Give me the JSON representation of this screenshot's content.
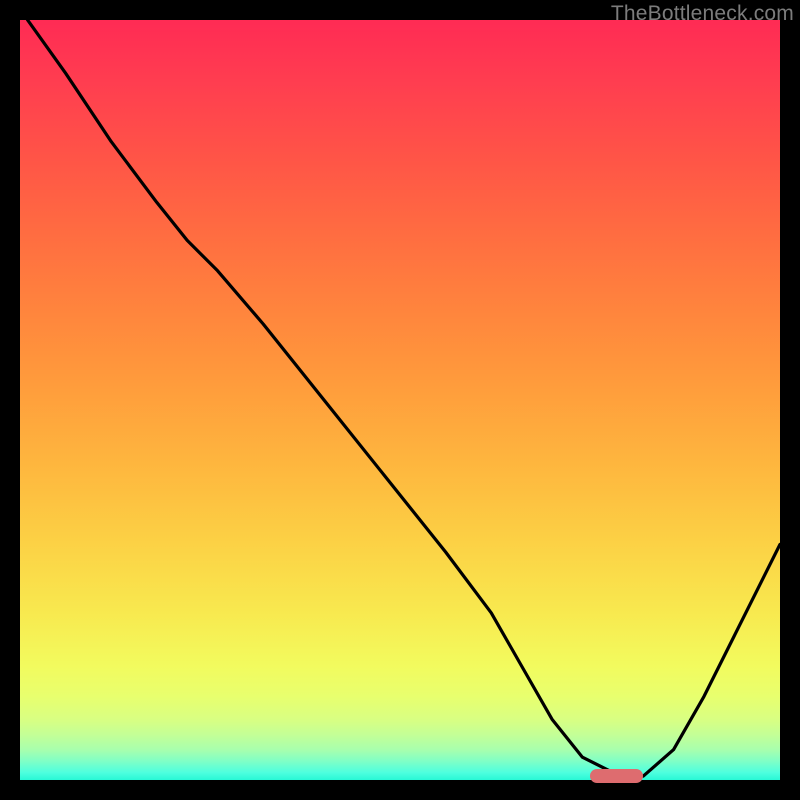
{
  "watermark_text": "TheBottleneck.com",
  "chart_data": {
    "type": "line",
    "title": "",
    "xlabel": "",
    "ylabel": "",
    "xlim": [
      0,
      100
    ],
    "ylim": [
      0,
      100
    ],
    "grid": false,
    "legend": false,
    "background": "rainbow-vertical-gradient",
    "series": [
      {
        "name": "bottleneck-curve",
        "color": "#000000",
        "x": [
          1,
          6,
          12,
          18,
          22,
          26,
          32,
          40,
          48,
          56,
          62,
          66,
          70,
          74,
          78,
          82,
          86,
          90,
          94,
          98,
          100
        ],
        "y": [
          100,
          93,
          84,
          76,
          71,
          67,
          60,
          50,
          40,
          30,
          22,
          15,
          8,
          3,
          1,
          0.5,
          4,
          11,
          19,
          27,
          31
        ]
      }
    ],
    "marker": {
      "name": "optimal-range",
      "color": "#de6c6f",
      "x_start": 75,
      "x_end": 82,
      "y": 0.5,
      "shape": "rounded-bar"
    }
  },
  "colors": {
    "frame": "#000000",
    "curve": "#000000",
    "marker": "#de6c6f",
    "watermark": "#7c7c7c"
  }
}
